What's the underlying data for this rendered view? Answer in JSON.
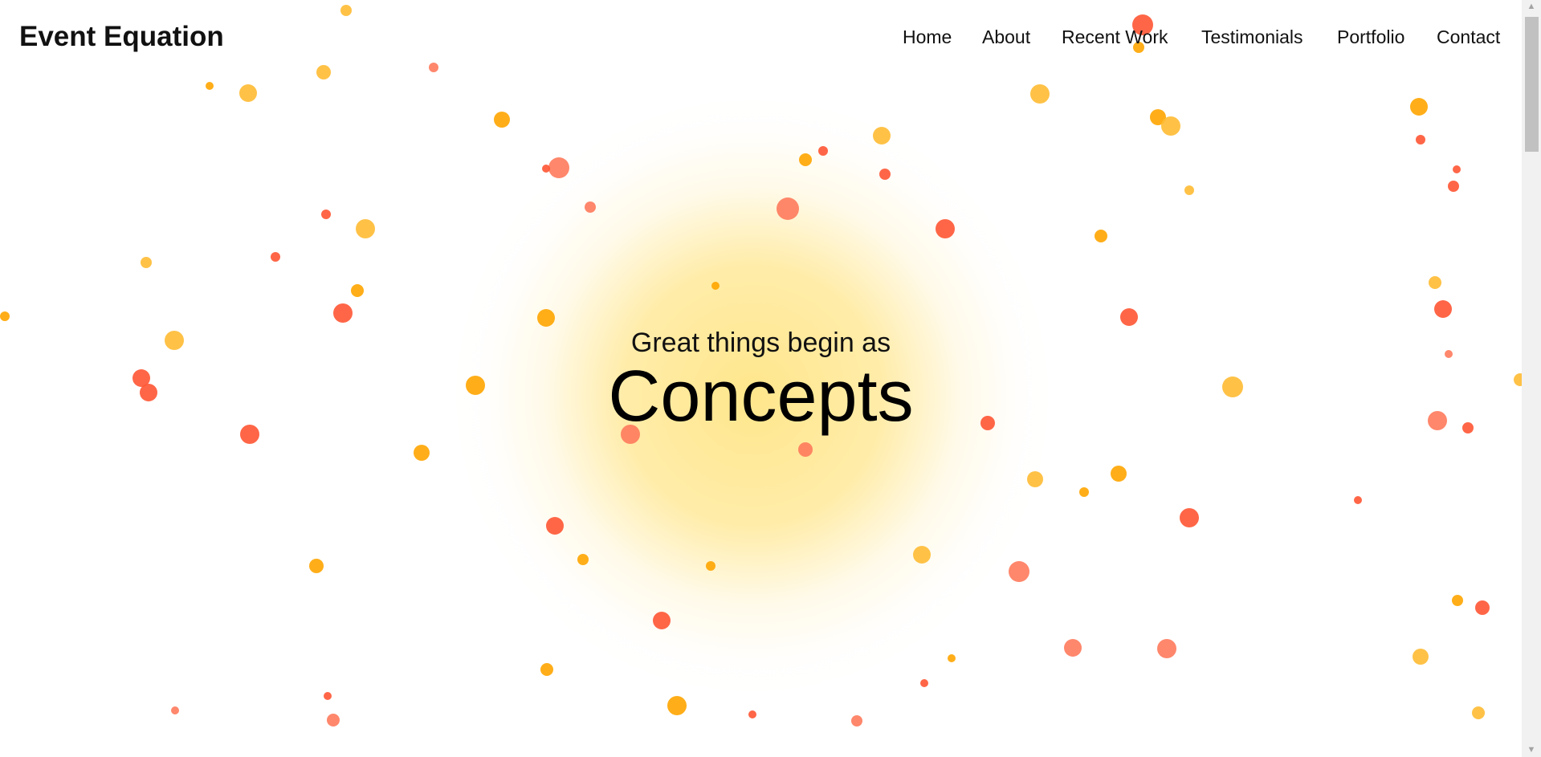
{
  "site": {
    "brand": "Event Equation"
  },
  "nav": {
    "items": [
      "Home",
      "About",
      "Recent Work",
      "Testimonials",
      "Portfolio",
      "Contact"
    ]
  },
  "hero": {
    "lead": "Great things begin as",
    "headline": "Concepts"
  },
  "colors": {
    "glow": "#ffe37a",
    "dot_orange": "#ffa500",
    "dot_amber": "#ffbb33",
    "dot_red": "#ff5533",
    "dot_coral": "#ff7a5c"
  },
  "scrollbar": {
    "up_icon": "▲",
    "down_icon": "▼"
  }
}
